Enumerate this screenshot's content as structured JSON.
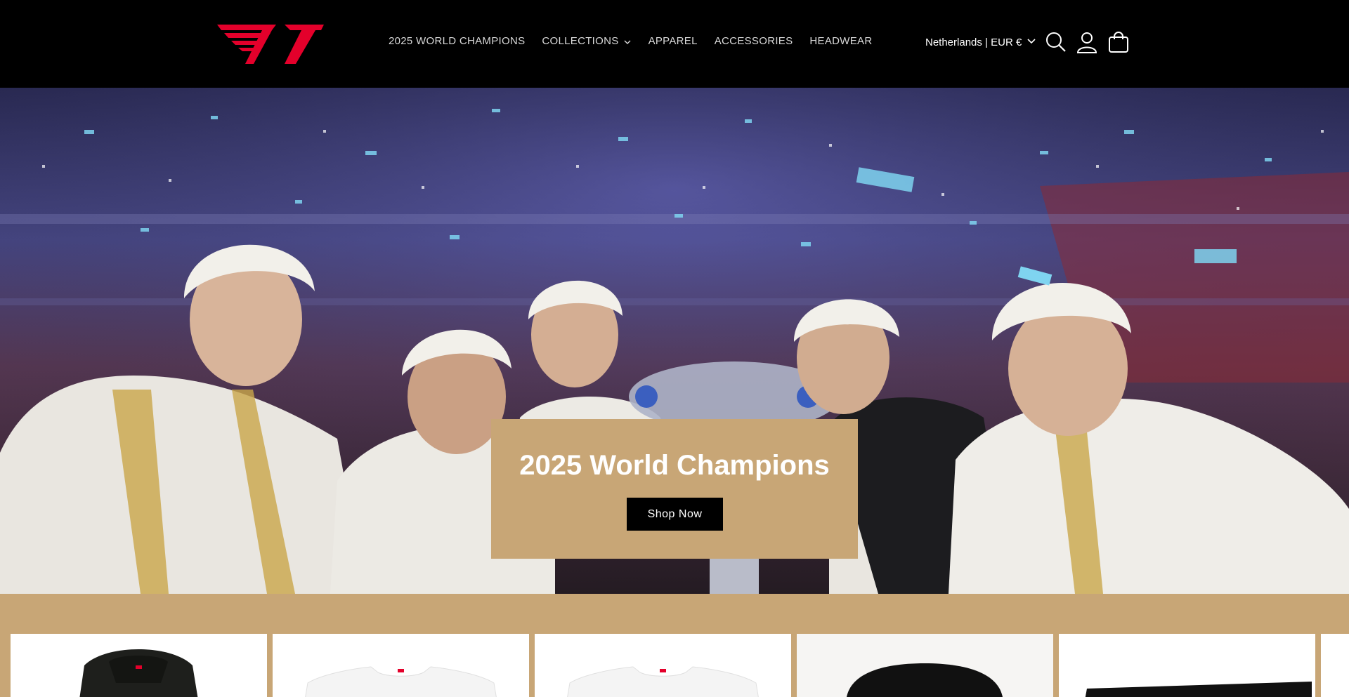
{
  "brand": {
    "logo_text": "T1",
    "accent_color": "#e4002b"
  },
  "nav": {
    "items": [
      {
        "label": "2025 WORLD CHAMPIONS",
        "has_dropdown": false
      },
      {
        "label": "COLLECTIONS",
        "has_dropdown": true
      },
      {
        "label": "APPAREL",
        "has_dropdown": false
      },
      {
        "label": "ACCESSORIES",
        "has_dropdown": false
      },
      {
        "label": "HEADWEAR",
        "has_dropdown": false
      }
    ]
  },
  "header": {
    "region_label": "Netherlands | EUR €",
    "icons": [
      "search-icon",
      "account-icon",
      "cart-icon"
    ]
  },
  "hero": {
    "title": "2025 World Champions",
    "cta_label": "Shop Now",
    "card_color": "#c8a676"
  },
  "products": {
    "items": [
      {
        "type": "hoodie",
        "color": "#1e1f1c"
      },
      {
        "type": "t-shirt",
        "color": "#f4f4f4"
      },
      {
        "type": "t-shirt",
        "color": "#f4f4f4"
      },
      {
        "type": "beanie",
        "color": "#111111"
      },
      {
        "type": "accessory",
        "color": "#111111"
      }
    ]
  }
}
